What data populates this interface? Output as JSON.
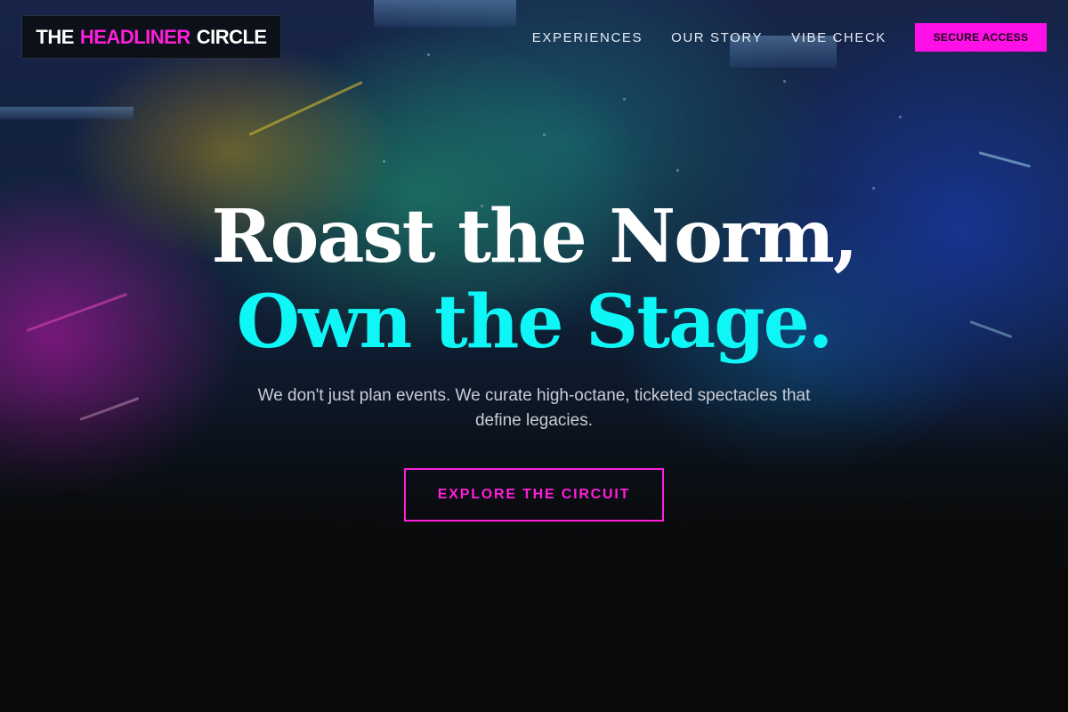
{
  "brand": {
    "logo_part1": "THE",
    "logo_part2": "HEADLINER",
    "logo_part3": "CIRCLE"
  },
  "nav": {
    "links": [
      "EXPERIENCES",
      "OUR STORY",
      "VIBE CHECK"
    ],
    "cta_label": "SECURE ACCESS"
  },
  "hero": {
    "headline_line1": "Roast the Norm,",
    "headline_line2": "Own the Stage.",
    "subtitle": "We don't just plan events. We curate high-octane, ticketed spectacles that define legacies.",
    "cta_label": "EXPLORE THE CIRCUIT"
  },
  "colors": {
    "accent_magenta": "#ff10e6",
    "accent_cyan": "#0ff6f6",
    "text_light": "#c9ccd4",
    "background": "#0a0a0a"
  }
}
